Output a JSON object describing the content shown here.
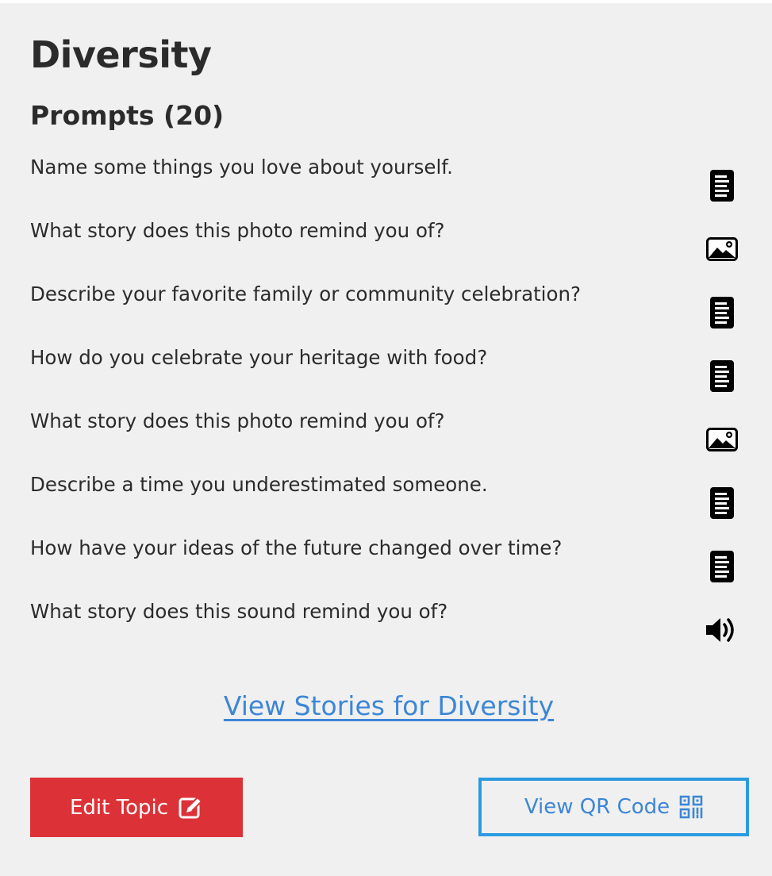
{
  "topic": {
    "title": "Diversity",
    "prompts_heading": "Prompts (20)"
  },
  "prompts": [
    {
      "text": "Name some things you love about yourself.",
      "icon": "document-icon"
    },
    {
      "text": "What story does this photo remind you of?",
      "icon": "image-icon"
    },
    {
      "text": "Describe your favorite family or community celebration?",
      "icon": "document-icon"
    },
    {
      "text": "How do you celebrate your heritage with food?",
      "icon": "document-icon"
    },
    {
      "text": "What story does this photo remind you of?",
      "icon": "image-icon"
    },
    {
      "text": "Describe a time you underestimated someone.",
      "icon": "document-icon"
    },
    {
      "text": "How have your ideas of the future changed over time?",
      "icon": "document-icon"
    },
    {
      "text": "What story does this sound remind you of?",
      "icon": "audio-icon"
    }
  ],
  "links": {
    "view_stories": "View Stories for Diversity"
  },
  "buttons": {
    "edit_topic": "Edit Topic",
    "edit_topic_icon": "edit-icon",
    "view_qr": "View QR Code",
    "view_qr_icon": "qr-code-icon"
  },
  "colors": {
    "background": "#f0f0f0",
    "text": "#2b2b2b",
    "link": "#3d86d6",
    "edit_button": "#dc3237",
    "qr_border": "#2b9be0"
  }
}
